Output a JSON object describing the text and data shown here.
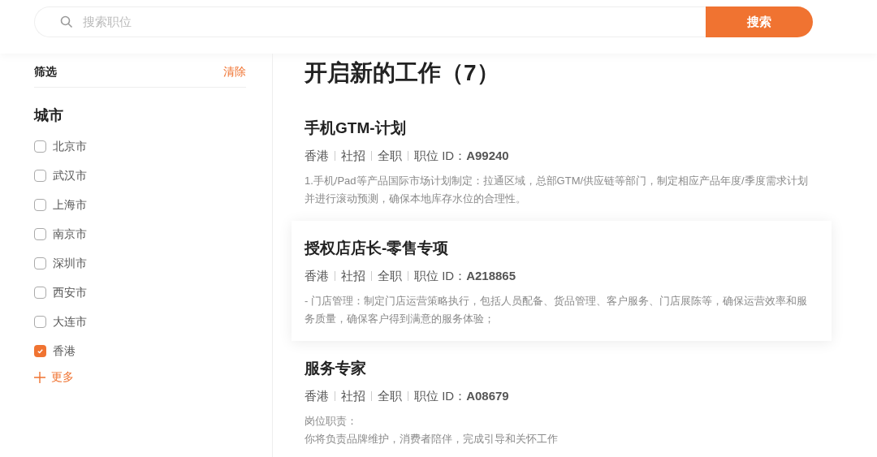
{
  "search": {
    "placeholder": "搜索职位",
    "button": "搜索"
  },
  "filter": {
    "title": "筛选",
    "clear": "清除",
    "group_title": "城市",
    "cities": [
      {
        "label": "北京市",
        "checked": false
      },
      {
        "label": "武汉市",
        "checked": false
      },
      {
        "label": "上海市",
        "checked": false
      },
      {
        "label": "南京市",
        "checked": false
      },
      {
        "label": "深圳市",
        "checked": false
      },
      {
        "label": "西安市",
        "checked": false
      },
      {
        "label": "大连市",
        "checked": false
      },
      {
        "label": "香港",
        "checked": true
      }
    ],
    "more": "更多"
  },
  "heading": "开启新的工作（7）",
  "jobs": [
    {
      "title": "手机GTM-计划",
      "tags": [
        "香港",
        "社招",
        "全职"
      ],
      "id_label": "职位 ID：",
      "id": "A99240",
      "selected": false,
      "description": [
        "1.手机/Pad等产品国际市场计划制定：拉通区域，总部GTM/供应链等部门，制定相应产品年度/季度需求计划并进行滚动预测，确保本地库存水位的合理性。"
      ]
    },
    {
      "title": "授权店店长-零售专项",
      "tags": [
        "香港",
        "社招",
        "全职"
      ],
      "id_label": "职位 ID：",
      "id": "A218865",
      "selected": true,
      "description": [
        "- 门店管理：制定门店运营策略执行，包括人员配备、货品管理、客户服务、门店展陈等，确保运营效率和服务质量，确保客户得到满意的服务体验；"
      ]
    },
    {
      "title": "服务专家",
      "tags": [
        "香港",
        "社招",
        "全职"
      ],
      "id_label": "职位 ID：",
      "id": "A08679",
      "selected": false,
      "description": [
        "岗位职责：",
        "你将负责品牌维护，消费者陪伴，完成引导和关怀工作"
      ]
    }
  ]
}
